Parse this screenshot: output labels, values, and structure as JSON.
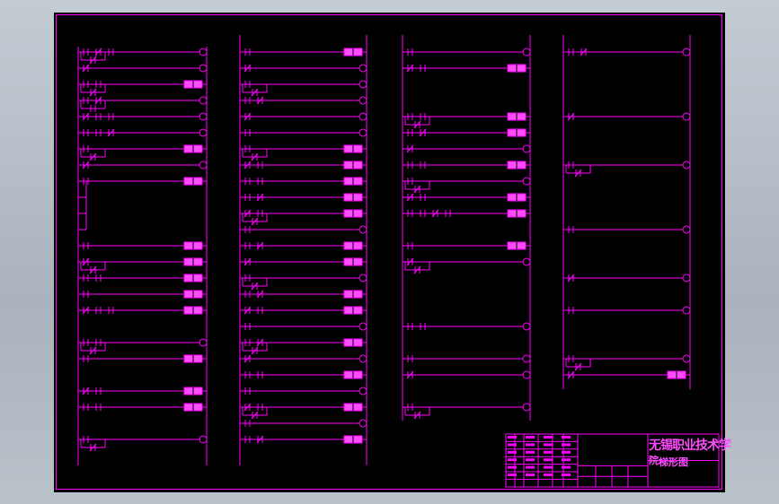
{
  "drawing": {
    "title_block": {
      "school_name_line1": "无锡职业技术学",
      "school_name_line2": "院",
      "drawing_name": "梯形图"
    }
  },
  "colors": {
    "background": "#000000",
    "lines": "#ff00ff",
    "coil_fill": "#ff4cff"
  }
}
